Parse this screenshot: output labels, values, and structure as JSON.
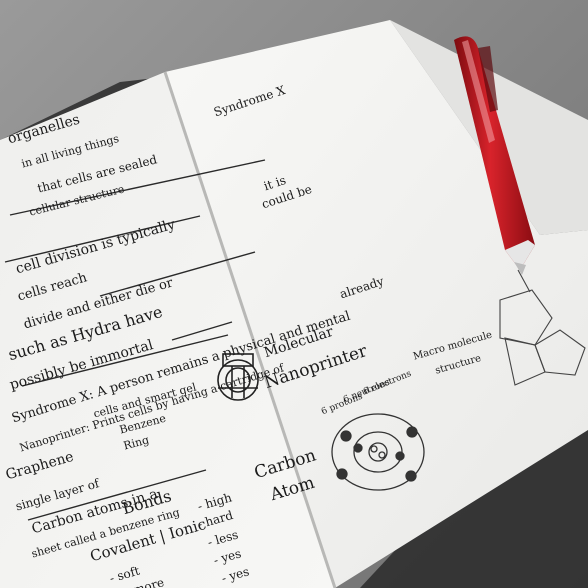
{
  "photo": {
    "subject": "open notebook with handwritten science notes and a red pen",
    "colors": {
      "paper": "#f4f4f2",
      "ink": "#1b1b1b",
      "pen": "#c4121a",
      "table": "#8f8f8f"
    }
  },
  "left_page": {
    "lines": [
      "organelles",
      "in all living things",
      "that cells are sealed",
      "cellular structure",
      "cell division is typically",
      "cells reach",
      "divide and either die or",
      "such as Hydra have",
      "possibly be immortal",
      "Syndrome X: A person remains a physical and mental",
      "Nanoprinter: Prints cells by having a cartridge of",
      "cells and smart gel",
      "Benzene",
      "Ring",
      "Graphene",
      "single layer of",
      "Carbon atoms in a",
      "sheet called a benzene ring",
      "Bonds",
      "Covalent | Ionic",
      "- soft",
      "- more",
      "- high",
      "- hard",
      "- less",
      "- yes",
      "- yes",
      "Molecular",
      "Nanoprinter",
      "Carbon",
      "Atom",
      "6 protons",
      "6 neutrons",
      "6 electrons"
    ]
  },
  "right_page": {
    "lines": [
      "Syndrome X",
      "could be",
      "it is",
      "already",
      "Macro molecule",
      "structure"
    ]
  }
}
